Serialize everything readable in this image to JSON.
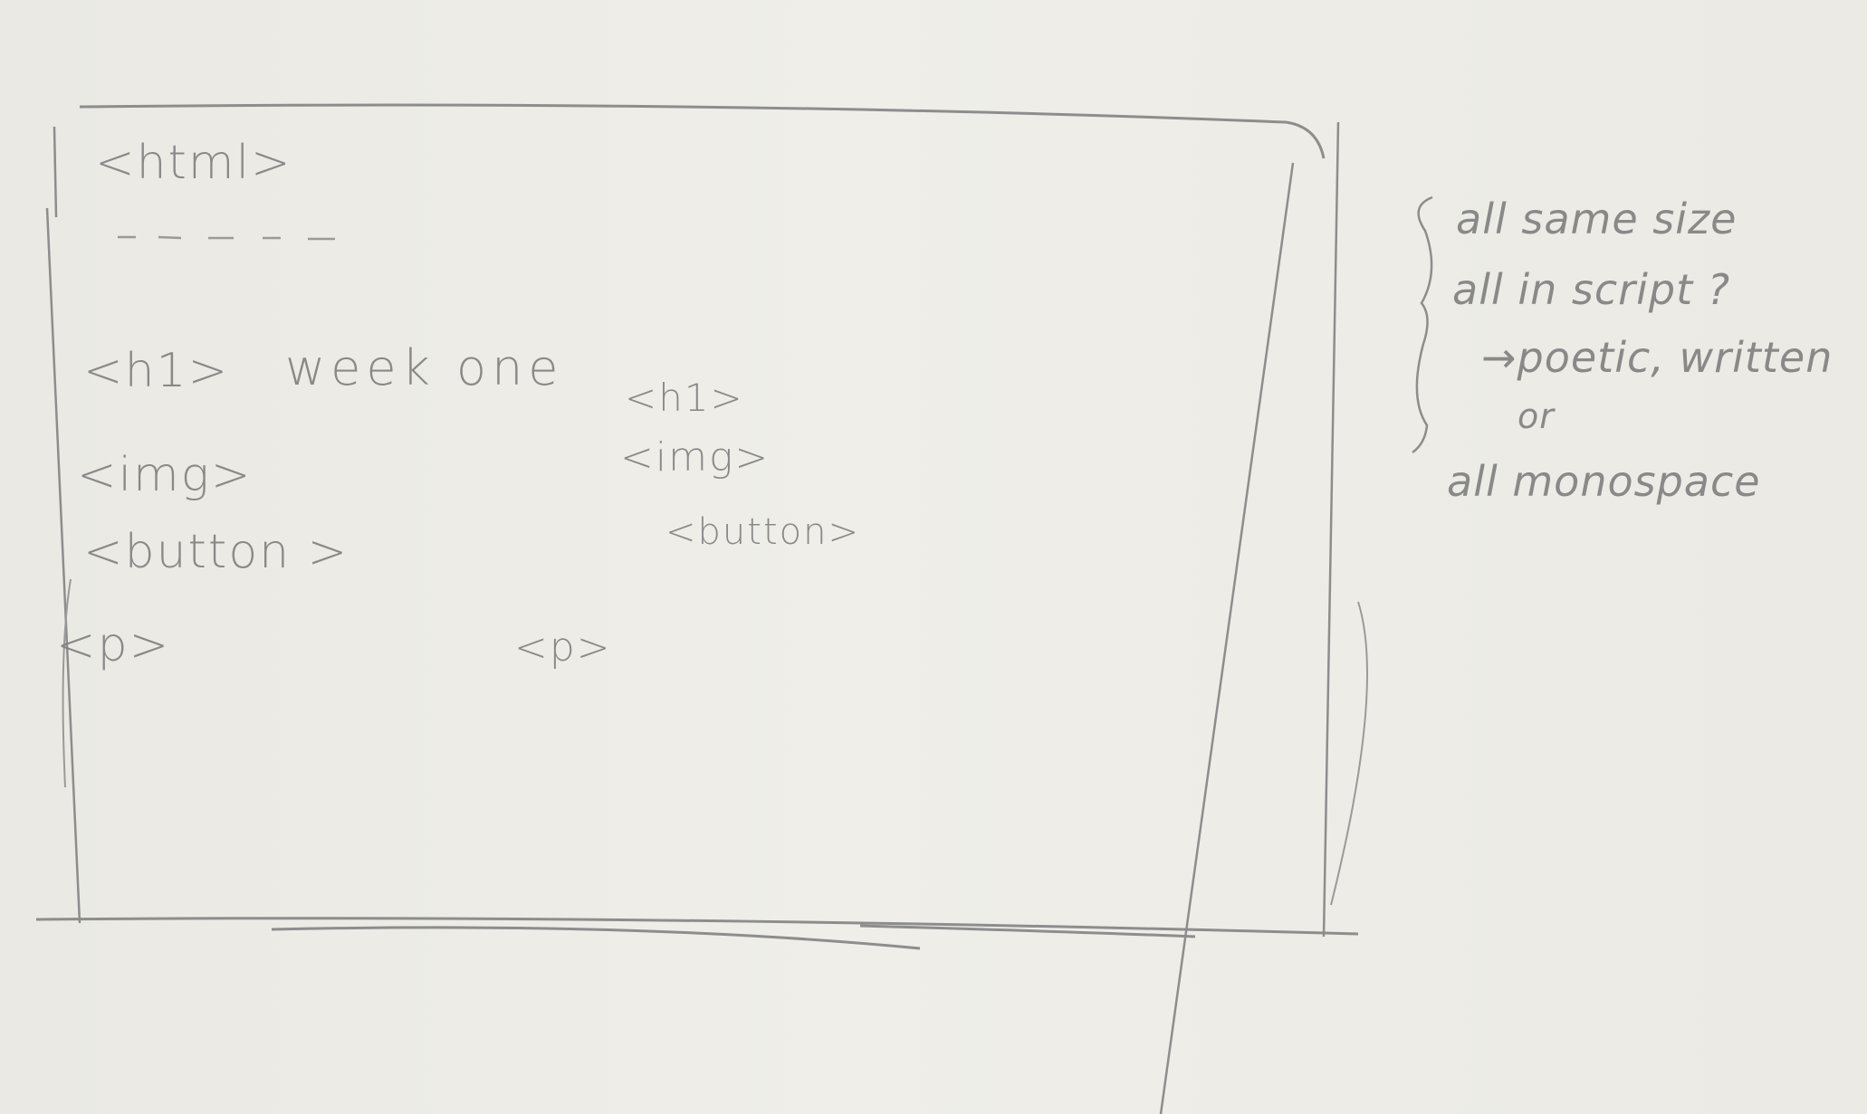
{
  "sketch": {
    "html_tag": "<html>",
    "h1_open": "<h1>",
    "h1_text": "week one",
    "h1_close": "<h1>",
    "img_open": "<img>",
    "img_close": "<img>",
    "button_open": "<button >",
    "button_close": "<button>",
    "p_open": "<p>",
    "p_close": "<p>"
  },
  "notes": [
    "all same size",
    "all in script ?",
    "→poetic, written",
    "or",
    "all monospace"
  ],
  "colors": {
    "paper": "#ecebe5",
    "pencil": "#7f7f80"
  }
}
